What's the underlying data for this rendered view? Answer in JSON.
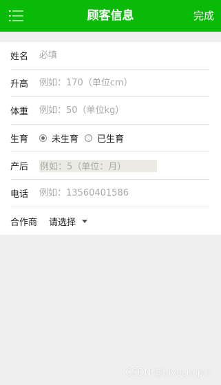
{
  "header": {
    "title": "顾客信息",
    "done_label": "完成"
  },
  "form": {
    "name": {
      "label": "姓名",
      "placeholder": "必填"
    },
    "height": {
      "label": "升高",
      "placeholder": "例如：170（单位cm）"
    },
    "weight": {
      "label": "体重",
      "placeholder": "例如：50（单位kg）"
    },
    "birth": {
      "label": "生育",
      "options": [
        "未生育",
        "已生育"
      ],
      "selected": "未生育"
    },
    "postpartum": {
      "label": "产后",
      "placeholder": "例如：5（单位：月）"
    },
    "phone": {
      "label": "电话",
      "placeholder": "例如：13560401586"
    },
    "partner": {
      "label": "合作商",
      "value": "请选择"
    }
  },
  "watermark": "CSDN @biyezuopin",
  "colors": {
    "brand_green": "#09bb07",
    "page_bg": "#efefef"
  },
  "icons": {
    "menu": "list-menu-icon",
    "caret": "chevron-down-icon"
  }
}
